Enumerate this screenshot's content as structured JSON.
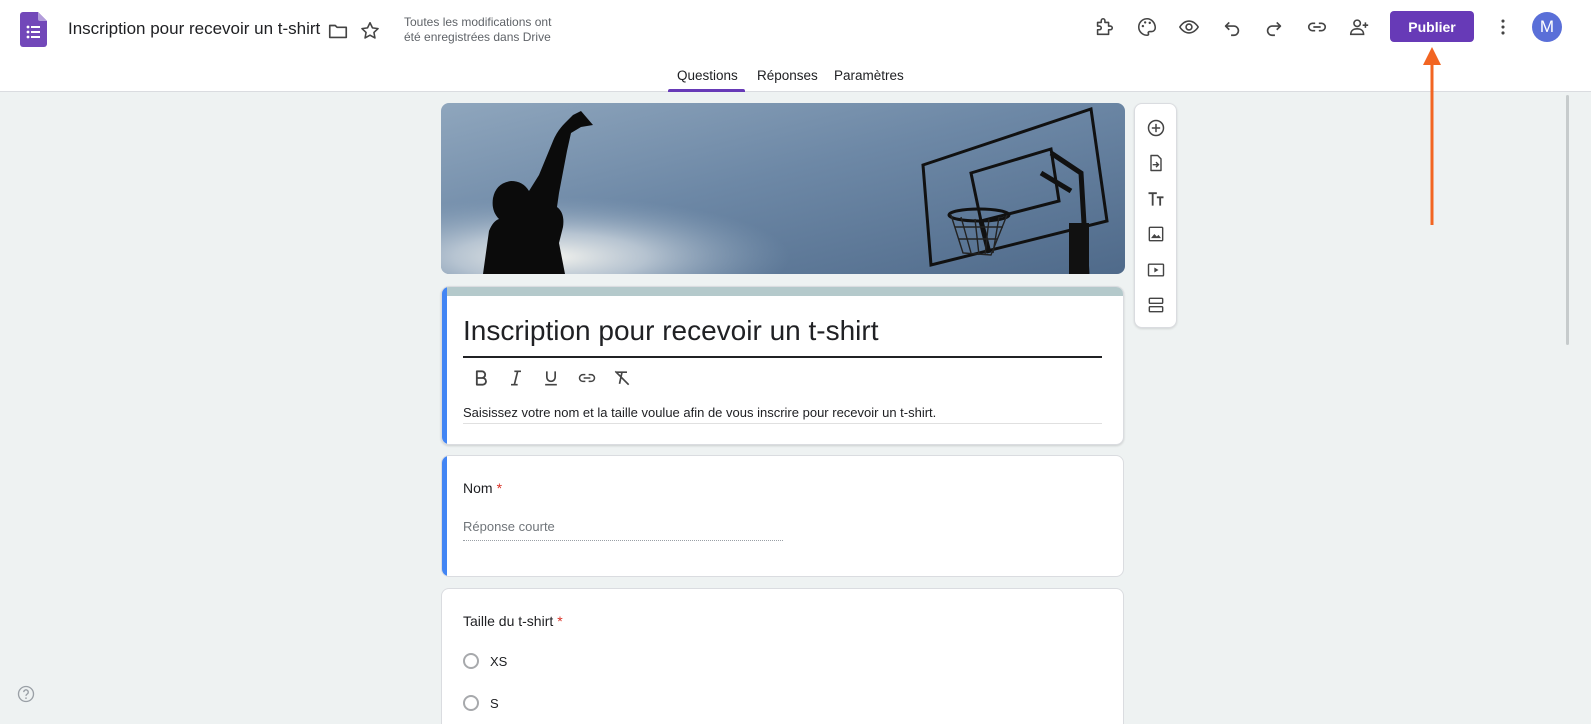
{
  "header": {
    "doc_title": "Inscription pour recevoir un t-shirt",
    "save_status": "Toutes les modifications ont été enregistrées dans Drive",
    "publish_label": "Publier",
    "avatar_initial": "M",
    "accent_color": "#673ab7"
  },
  "tabs": [
    {
      "label": "Questions",
      "active": true
    },
    {
      "label": "Réponses",
      "active": false
    },
    {
      "label": "Paramètres",
      "active": false
    }
  ],
  "form": {
    "title": "Inscription pour recevoir un t-shirt",
    "description": "Saisissez votre nom et la taille voulue afin de vous inscrire pour recevoir un t-shirt."
  },
  "questions": [
    {
      "title": "Nom",
      "required_mark": "*",
      "placeholder": "Réponse courte"
    },
    {
      "title": "Taille du t-shirt",
      "required_mark": "*",
      "options": [
        "XS",
        "S"
      ]
    }
  ],
  "icons": {
    "toolbar": [
      "addon-puzzle-icon",
      "palette-icon",
      "preview-eye-icon",
      "undo-icon",
      "redo-icon",
      "link-icon",
      "add-collaborator-icon",
      "more-vert-icon"
    ],
    "side": [
      "add-question-icon",
      "import-questions-icon",
      "add-title-icon",
      "add-image-icon",
      "add-video-icon",
      "add-section-icon"
    ]
  }
}
